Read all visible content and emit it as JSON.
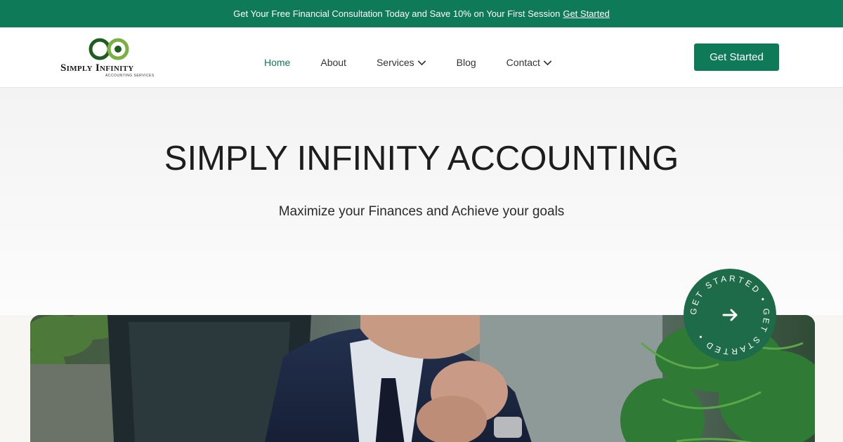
{
  "announcement": {
    "text": "Get Your Free Financial Consultation Today and Save 10% on Your First Session",
    "link_label": "Get Started"
  },
  "logo": {
    "name": "Simply Infinity",
    "tagline": "Accounting Services"
  },
  "nav": {
    "items": [
      {
        "label": "Home",
        "active": true
      },
      {
        "label": "About"
      },
      {
        "label": "Services",
        "dropdown": true
      },
      {
        "label": "Blog"
      },
      {
        "label": "Contact",
        "dropdown": true
      }
    ]
  },
  "header_cta": {
    "label": "Get Started"
  },
  "hero": {
    "title": "SIMPLY INFINITY ACCOUNTING",
    "subtitle": "Maximize your Finances and Achieve your goals"
  },
  "badge": {
    "ring_text": "GET STARTED • GET STARTED •",
    "icon": "arrow-right-icon"
  },
  "colors": {
    "brand_green": "#0f7a57",
    "badge_green": "#1e6b4a",
    "logo_dark_green": "#1f5c1f",
    "logo_light_green": "#7bb043"
  }
}
